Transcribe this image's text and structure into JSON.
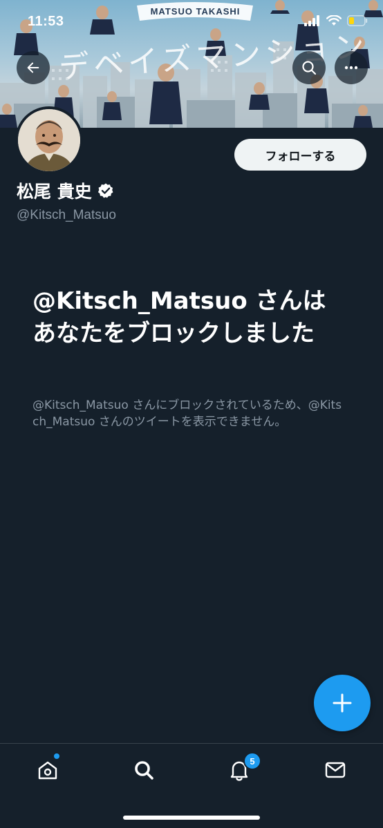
{
  "status_bar": {
    "time": "11:53"
  },
  "banner": {
    "caption": "MATSUO TAKASHI",
    "title_text": "デベイズマンション"
  },
  "profile": {
    "display_name": "松尾 貴史",
    "handle": "@Kitsch_Matsuo",
    "verified": true,
    "follow_label": "フォローする"
  },
  "blocked": {
    "title": "@Kitsch_Matsuo さんはあなたをブロックしました",
    "message": "@Kitsch_Matsuo さんにブロックされているため、@Kitsch_Matsuo さんのツイートを表示できません。"
  },
  "bottom_nav": {
    "notifications_count": "5"
  },
  "colors": {
    "background": "#15202b",
    "accent": "#1d9bf0",
    "secondary_text": "#8b98a5"
  },
  "icons": {
    "back": "arrow-left-icon",
    "search": "search-icon",
    "more": "more-horizontal-icon",
    "verified": "verified-badge-icon",
    "compose": "plus-icon",
    "home": "home-icon",
    "explore": "search-icon",
    "notifications": "bell-icon",
    "messages": "mail-icon"
  }
}
